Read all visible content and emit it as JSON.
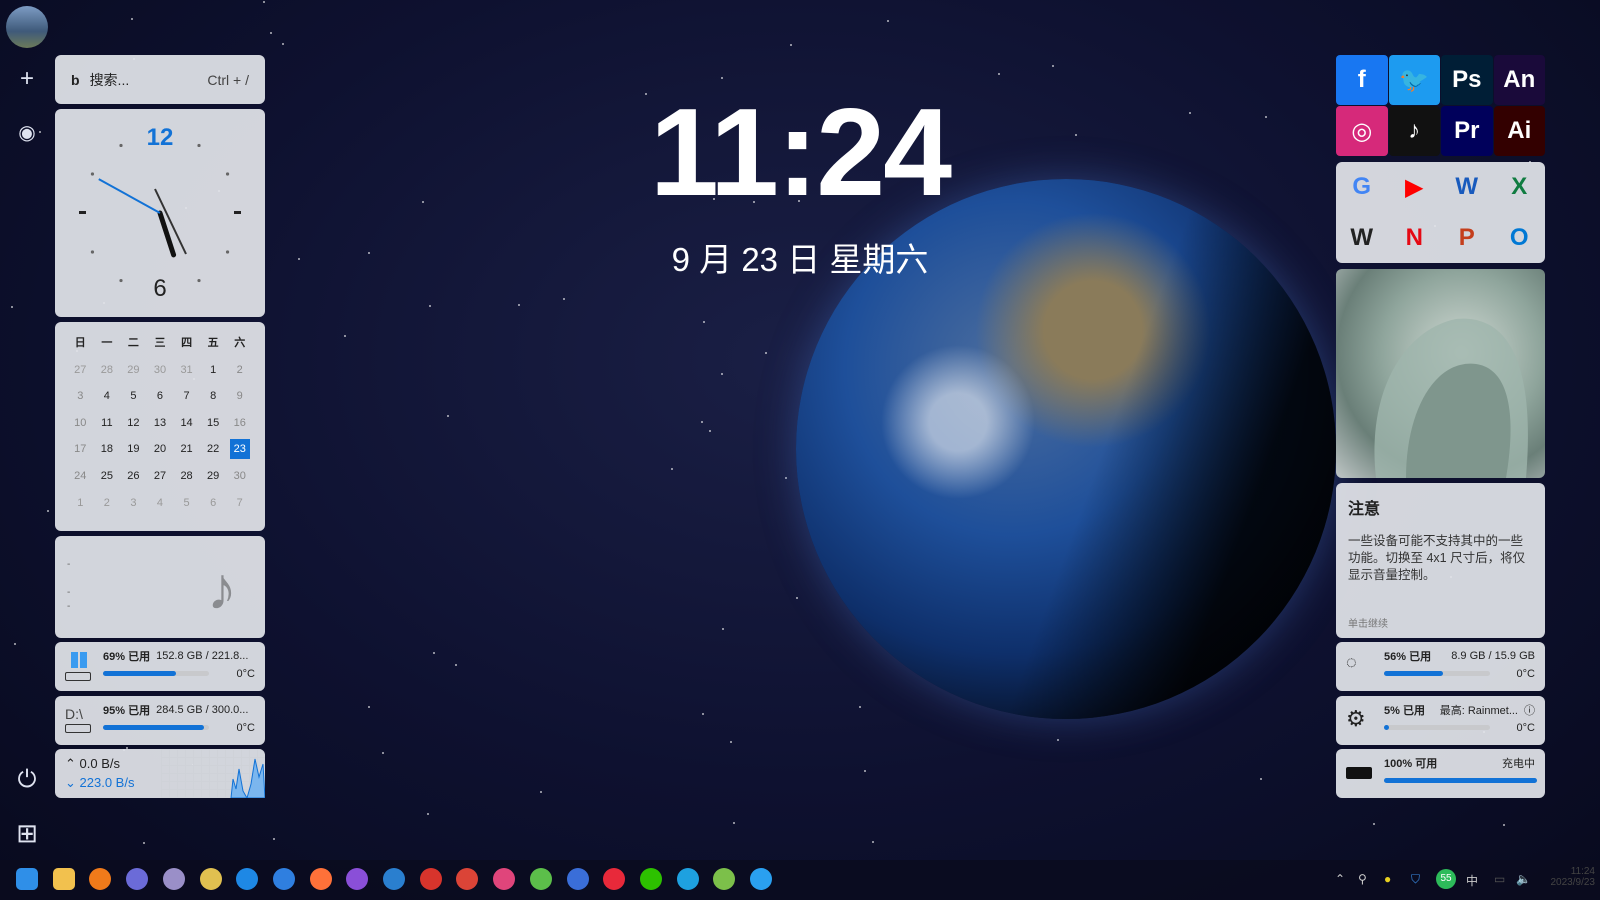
{
  "clock_display": {
    "time": "11:24",
    "date": "9 月 23 日 星期六"
  },
  "search": {
    "placeholder": "搜索...",
    "shortcut": "Ctrl + /"
  },
  "analog_clock": {
    "label_12": "12",
    "label_6": "6",
    "hour": 11,
    "minute": 24
  },
  "calendar": {
    "headers": [
      "日",
      "一",
      "二",
      "三",
      "四",
      "五",
      "六"
    ],
    "weeks": [
      [
        "27",
        "28",
        "29",
        "30",
        "31",
        "1",
        "2"
      ],
      [
        "3",
        "4",
        "5",
        "6",
        "7",
        "8",
        "9"
      ],
      [
        "10",
        "11",
        "12",
        "13",
        "14",
        "15",
        "16"
      ],
      [
        "17",
        "18",
        "19",
        "20",
        "21",
        "22",
        "23"
      ],
      [
        "24",
        "25",
        "26",
        "27",
        "28",
        "29",
        "30"
      ],
      [
        "1",
        "2",
        "3",
        "4",
        "5",
        "6",
        "7"
      ]
    ],
    "today": "23"
  },
  "disk_c": {
    "percent_label": "69% 已用",
    "detail": "152.8 GB / 221.8...",
    "temp": "0°C",
    "percent": 69
  },
  "disk_d": {
    "drive": "D:\\",
    "percent_label": "95% 已用",
    "detail": "284.5 GB / 300.0...",
    "temp": "0°C",
    "percent": 95
  },
  "network": {
    "up": "0.0 B/s",
    "down": "223.0 B/s"
  },
  "apps": [
    {
      "name": "Facebook",
      "label": "f",
      "color": "#1877f2"
    },
    {
      "name": "Twitter",
      "label": "🐦",
      "color": "#1d9bf0"
    },
    {
      "name": "Photoshop",
      "label": "Ps",
      "color": "#001e36"
    },
    {
      "name": "Animate",
      "label": "An",
      "color": "#1a0a3a"
    },
    {
      "name": "Instagram",
      "label": "◎",
      "color": "#d6297a"
    },
    {
      "name": "TikTok",
      "label": "♪",
      "color": "#111111"
    },
    {
      "name": "Premiere",
      "label": "Pr",
      "color": "#00005b"
    },
    {
      "name": "Illustrator",
      "label": "Ai",
      "color": "#330000"
    }
  ],
  "apps2": [
    {
      "name": "Google",
      "label": "G",
      "color": "#4285f4"
    },
    {
      "name": "YouTube",
      "label": "▶",
      "color": "#ff0000"
    },
    {
      "name": "Word",
      "label": "W",
      "color": "#185abd"
    },
    {
      "name": "Excel",
      "label": "X",
      "color": "#107c41"
    },
    {
      "name": "Wikipedia",
      "label": "W",
      "color": "#222222"
    },
    {
      "name": "Netflix",
      "label": "N",
      "color": "#e50914"
    },
    {
      "name": "PowerPoint",
      "label": "P",
      "color": "#c43e1c"
    },
    {
      "name": "Outlook",
      "label": "O",
      "color": "#0078d4"
    }
  ],
  "note": {
    "title": "注意",
    "body": "一些设备可能不支持其中的一些功能。切换至 4x1 尺寸后，将仅显示音量控制。",
    "hint": "单击继续"
  },
  "memory": {
    "percent_label": "56% 已用",
    "detail": "8.9 GB / 15.9 GB",
    "temp": "0°C",
    "percent": 56
  },
  "cpu": {
    "percent_label": "5% 已用",
    "detail": "最高: Rainmet...",
    "temp": "0°C",
    "percent": 5
  },
  "battery": {
    "percent_label": "100% 可用",
    "status": "充电中",
    "percent": 100
  },
  "tray": {
    "ime": "中",
    "badge": "55",
    "time": "11:24",
    "date": "2023/9/23"
  },
  "taskbar_colors": [
    "#2f8fe8",
    "#f2c14e",
    "#f07a1a",
    "#6b6bd8",
    "#9a8fc8",
    "#e0c050",
    "#1e88e5",
    "#2f7fe0",
    "#ff7139",
    "#8a4fd8",
    "#2a7fcf",
    "#d8342c",
    "#db4437",
    "#e0457b",
    "#5cbf4a",
    "#3a6ed8",
    "#e8293a",
    "#2dc100",
    "#1ea1e0",
    "#7cc04a",
    "#2aa0f0"
  ]
}
